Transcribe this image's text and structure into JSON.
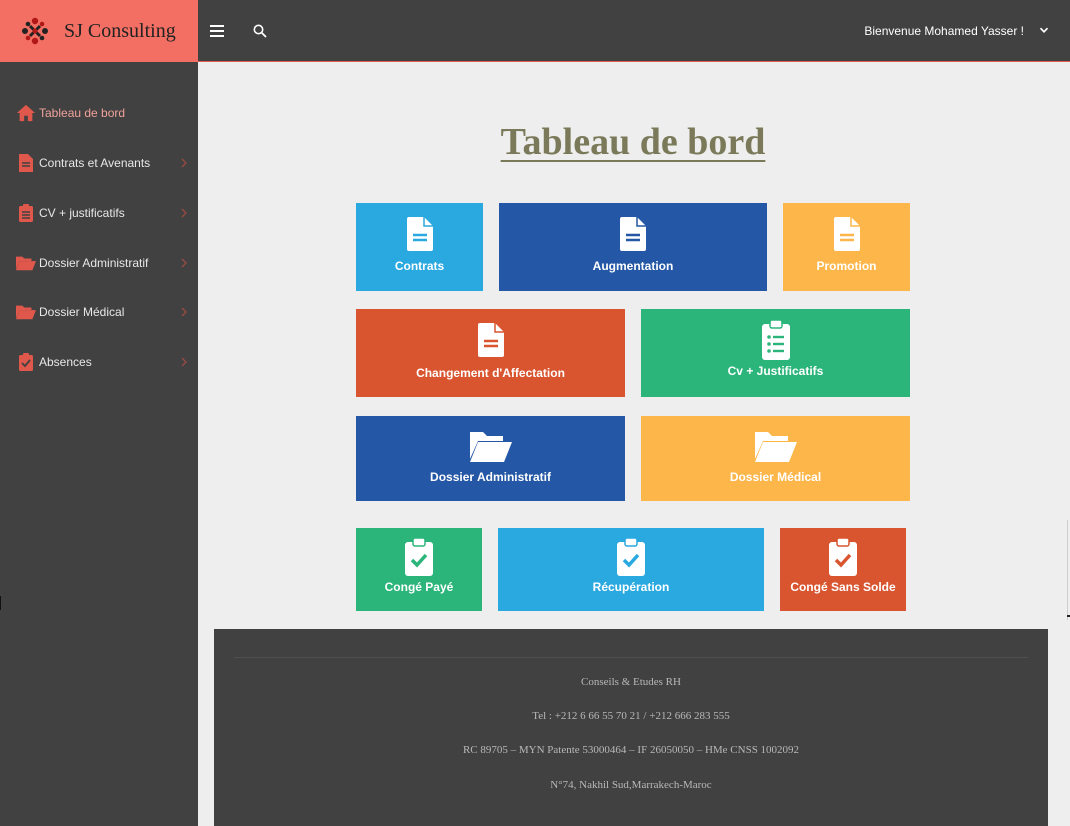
{
  "brand": {
    "name": "SJ Consulting",
    "logo_icon": "sj-logo-icon"
  },
  "topbar": {
    "menu_icon": "hamburger-icon",
    "search_icon": "search-icon",
    "welcome": "Bienvenue Mohamed Yasser !",
    "caret_icon": "chevron-down-icon"
  },
  "sidebar": {
    "items": [
      {
        "label": "Tableau de bord",
        "icon": "home-icon",
        "active": true
      },
      {
        "label": "Contrats et Avenants",
        "icon": "file-icon"
      },
      {
        "label": "CV + justificatifs",
        "icon": "clipboard-list-icon"
      },
      {
        "label": "Dossier Administratif",
        "icon": "folder-open-icon"
      },
      {
        "label": "Dossier Médical",
        "icon": "folder-open-icon"
      },
      {
        "label": "Absences",
        "icon": "clipboard-check-icon"
      }
    ]
  },
  "main": {
    "title": "Tableau de bord",
    "tiles": [
      {
        "label": "Contrats",
        "icon": "file-icon",
        "color": "#2aa9e0"
      },
      {
        "label": "Augmentation",
        "icon": "file-icon",
        "color": "#2457a5"
      },
      {
        "label": "Promotion",
        "icon": "file-icon",
        "color": "#fdb64a"
      },
      {
        "label": "Changement d'Affectation",
        "icon": "file-icon",
        "color": "#d9552f"
      },
      {
        "label": "Cv + Justificatifs",
        "icon": "clipboard-list-icon",
        "color": "#2bb57a"
      },
      {
        "label": "Dossier Administratif",
        "icon": "folder-open-icon",
        "color": "#2457a5"
      },
      {
        "label": "Dossier Médical",
        "icon": "folder-open-icon",
        "color": "#fdb64a"
      },
      {
        "label": "Congé Payé",
        "icon": "clipboard-check-icon",
        "color": "#2bb57a"
      },
      {
        "label": "Récupération",
        "icon": "clipboard-check-icon",
        "color": "#2aa9e0"
      },
      {
        "label": "Congé Sans Solde",
        "icon": "clipboard-check-icon",
        "color": "#d9552f"
      }
    ]
  },
  "footer": {
    "lines": [
      "Conseils & Etudes RH",
      "Tel : +212 6 66 55 70 21 / +212 666 283 555",
      "RC 89705 – MYN Patente 53000464 – IF 26050050 – HMe CNSS 1002092",
      "N°74, Nakhil Sud,Marrakech-Maroc"
    ]
  },
  "colors": {
    "brand_bg": "#f46f63",
    "dark_bg": "#414141",
    "content_bg": "#eeeeee",
    "sidebar_icon": "#e0574b"
  }
}
